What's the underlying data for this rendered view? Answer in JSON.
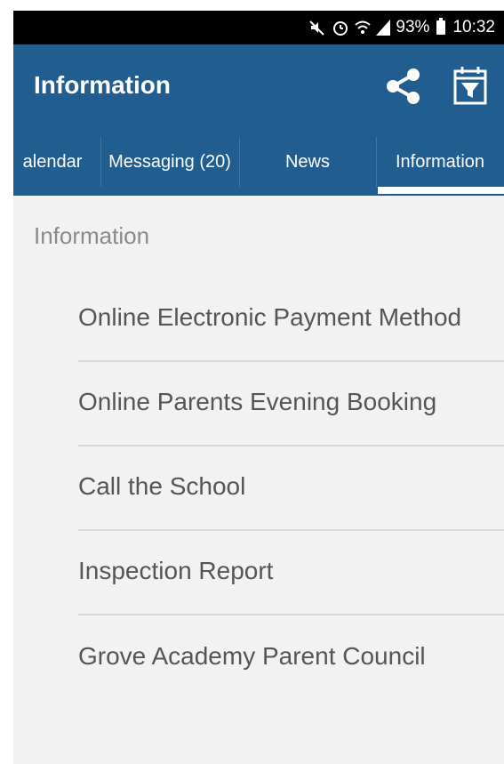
{
  "status_bar": {
    "battery_percent": "93%",
    "time": "10:32",
    "icons": [
      "mute-icon",
      "alarm-icon",
      "wifi-icon",
      "signal-icon",
      "battery-icon"
    ]
  },
  "app_bar": {
    "title": "Information",
    "actions": [
      "share-icon",
      "calendar-filter-icon"
    ]
  },
  "tabs": [
    {
      "label": "alendar"
    },
    {
      "label": "Messaging (20)"
    },
    {
      "label": "News"
    },
    {
      "label": "Information",
      "active": true
    }
  ],
  "content": {
    "section_title": "Information",
    "items": [
      {
        "label": "Online Electronic Payment Method"
      },
      {
        "label": "Online Parents Evening Booking"
      },
      {
        "label": "Call the School"
      },
      {
        "label": "Inspection Report"
      },
      {
        "label": "Grove Academy Parent Council"
      }
    ]
  },
  "colors": {
    "primary": "#225d8f",
    "background": "#f2f2f2",
    "status_bar": "#000000",
    "list_text": "#555555",
    "section_text": "#8a8a8a",
    "divider": "#d8d8d8"
  }
}
